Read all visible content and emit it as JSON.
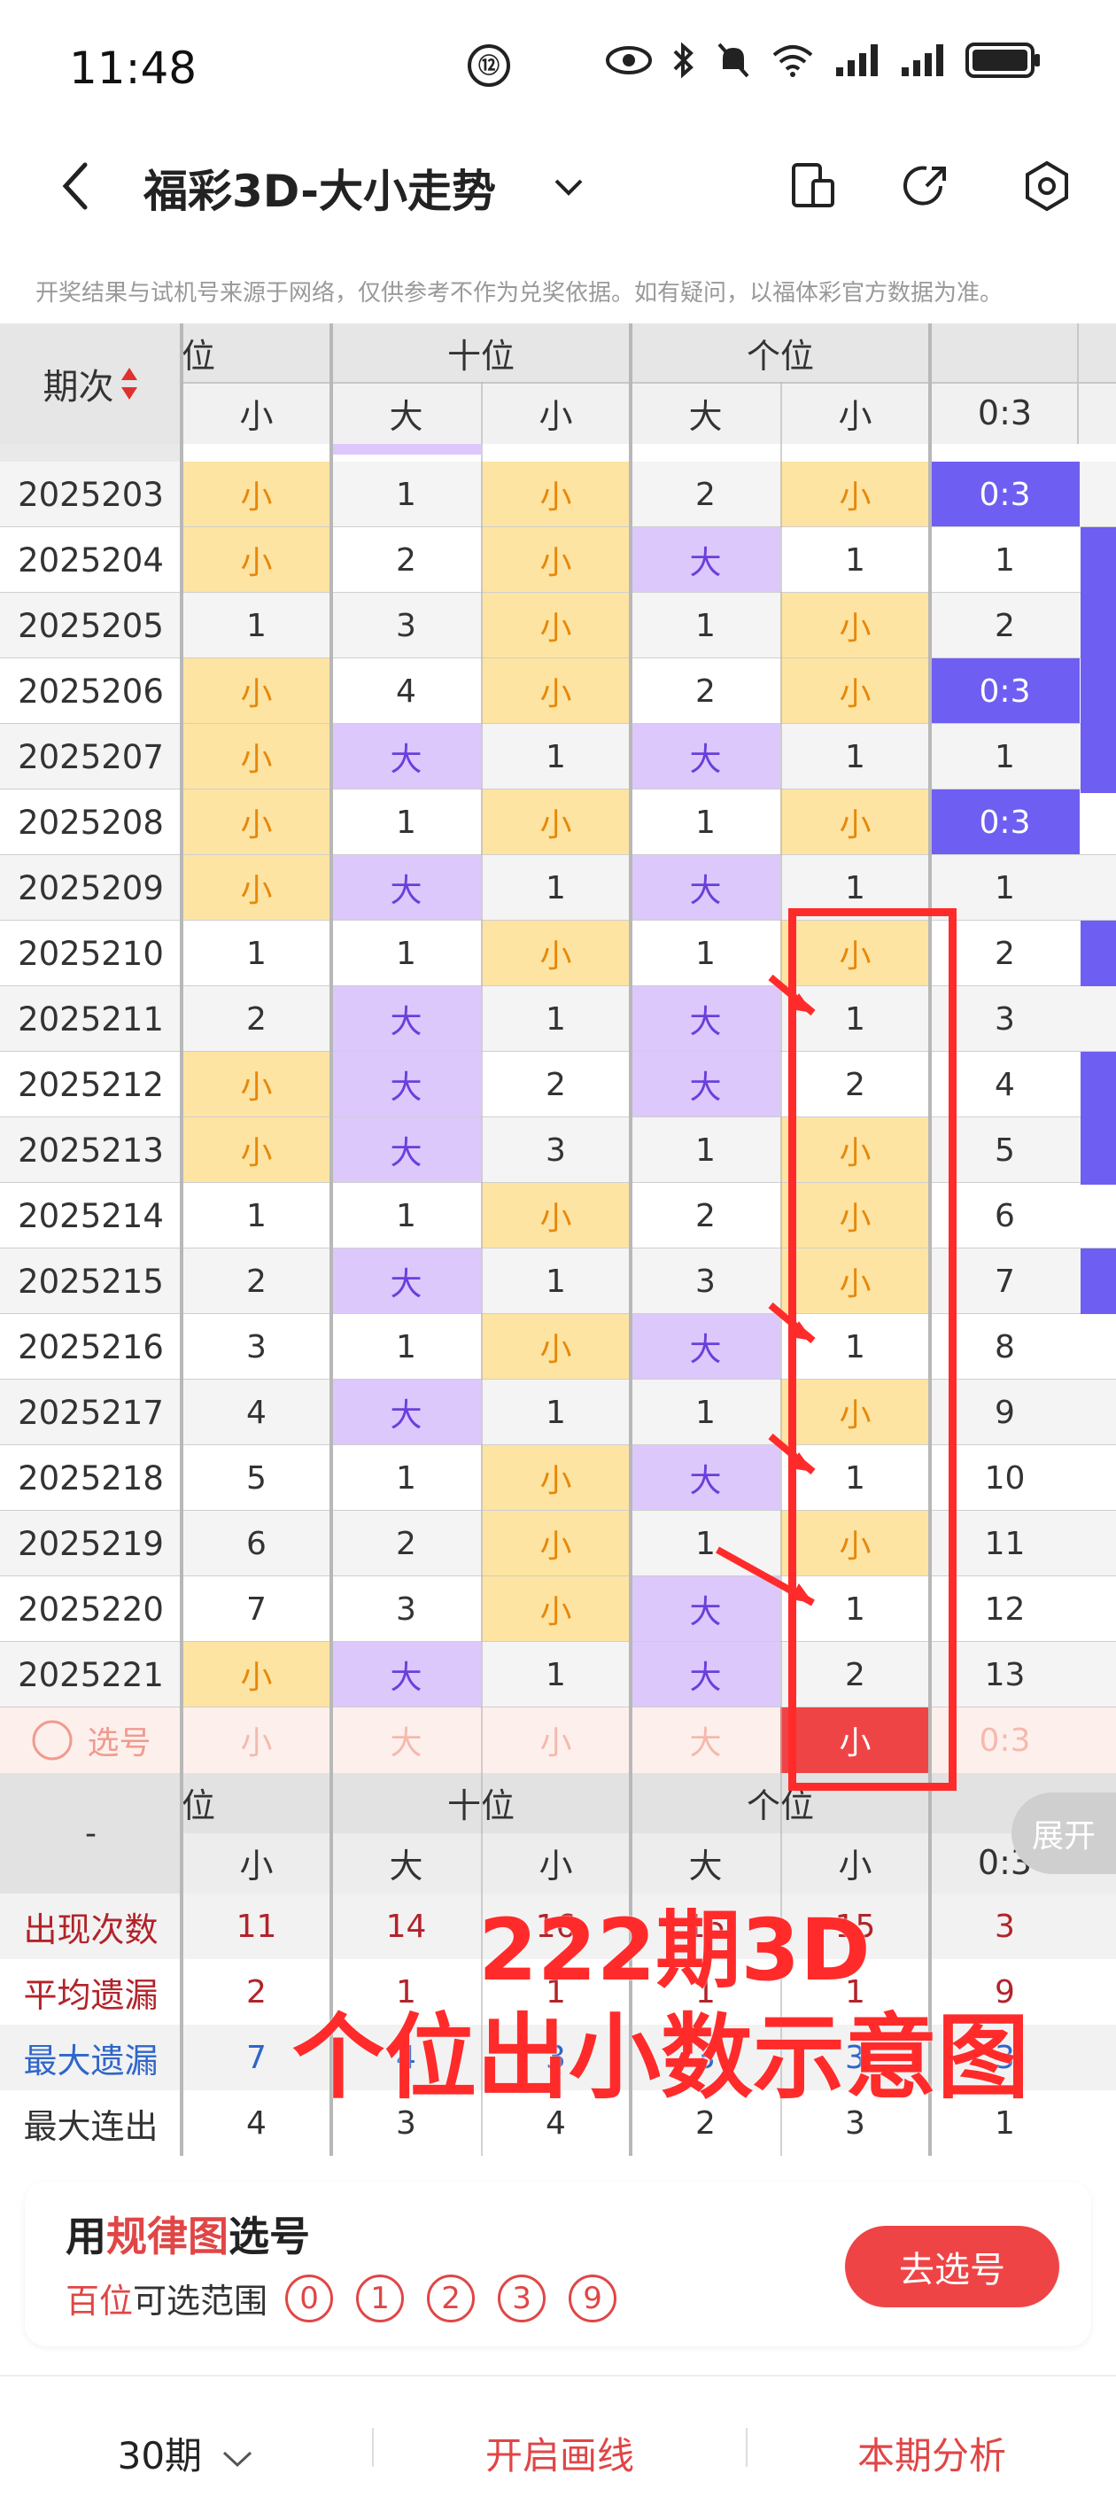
{
  "status": {
    "time": "11:48",
    "badge": "⑫"
  },
  "header": {
    "title": "福彩3D-大小走势"
  },
  "notice": "开奖结果与试机号来源于网络，仅供参考不作为兑奖依据。如有疑问，以福体彩官方数据为准。",
  "table_header": {
    "period_label": "期次",
    "groups": [
      "位",
      "十位",
      "个位"
    ],
    "subheads": [
      "小",
      "大",
      "小",
      "大",
      "小",
      "0:3"
    ]
  },
  "rows": [
    {
      "period": "2025203",
      "cells": [
        "小",
        "1",
        "小",
        "2",
        "小",
        "0:3"
      ]
    },
    {
      "period": "2025204",
      "cells": [
        "小",
        "2",
        "小",
        "大",
        "1",
        "1"
      ]
    },
    {
      "period": "2025205",
      "cells": [
        "1",
        "3",
        "小",
        "1",
        "小",
        "2"
      ]
    },
    {
      "period": "2025206",
      "cells": [
        "小",
        "4",
        "小",
        "2",
        "小",
        "0:3"
      ]
    },
    {
      "period": "2025207",
      "cells": [
        "小",
        "大",
        "1",
        "大",
        "1",
        "1"
      ]
    },
    {
      "period": "2025208",
      "cells": [
        "小",
        "1",
        "小",
        "1",
        "小",
        "0:3"
      ]
    },
    {
      "period": "2025209",
      "cells": [
        "小",
        "大",
        "1",
        "大",
        "1",
        "1"
      ]
    },
    {
      "period": "2025210",
      "cells": [
        "1",
        "1",
        "小",
        "1",
        "小",
        "2"
      ]
    },
    {
      "period": "2025211",
      "cells": [
        "2",
        "大",
        "1",
        "大",
        "1",
        "3"
      ]
    },
    {
      "period": "2025212",
      "cells": [
        "小",
        "大",
        "2",
        "大",
        "2",
        "4"
      ]
    },
    {
      "period": "2025213",
      "cells": [
        "小",
        "大",
        "3",
        "1",
        "小",
        "5"
      ]
    },
    {
      "period": "2025214",
      "cells": [
        "1",
        "1",
        "小",
        "2",
        "小",
        "6"
      ]
    },
    {
      "period": "2025215",
      "cells": [
        "2",
        "大",
        "1",
        "3",
        "小",
        "7"
      ]
    },
    {
      "period": "2025216",
      "cells": [
        "3",
        "1",
        "小",
        "大",
        "1",
        "8"
      ]
    },
    {
      "period": "2025217",
      "cells": [
        "4",
        "大",
        "1",
        "1",
        "小",
        "9"
      ]
    },
    {
      "period": "2025218",
      "cells": [
        "5",
        "1",
        "小",
        "大",
        "1",
        "10"
      ]
    },
    {
      "period": "2025219",
      "cells": [
        "6",
        "2",
        "小",
        "1",
        "小",
        "11"
      ]
    },
    {
      "period": "2025220",
      "cells": [
        "7",
        "3",
        "小",
        "大",
        "1",
        "12"
      ]
    },
    {
      "period": "2025221",
      "cells": [
        "小",
        "大",
        "1",
        "大",
        "2",
        "13"
      ]
    }
  ],
  "select_row": {
    "label": "选号",
    "cells": [
      "小",
      "大",
      "小",
      "大",
      "小",
      "0:3"
    ]
  },
  "stats_header": {
    "dash": "-",
    "groups": [
      "位",
      "十位",
      "个位"
    ],
    "subheads": [
      "小",
      "大",
      "小",
      "大",
      "小",
      "0:3"
    ],
    "expand": "展开"
  },
  "stats": [
    {
      "label": "出现次数",
      "cells": [
        "11",
        "14",
        "16",
        "15",
        "15",
        "3"
      ]
    },
    {
      "label": "平均遗漏",
      "cells": [
        "2",
        "1",
        "1",
        "1",
        "1",
        "9"
      ]
    },
    {
      "label": "最大遗漏",
      "cells": [
        "7",
        "4",
        "3",
        "3",
        "3",
        "3"
      ]
    },
    {
      "label": "最大连出",
      "cells": [
        "4",
        "3",
        "4",
        "2",
        "3",
        "1"
      ]
    }
  ],
  "overlay": {
    "line1": "222期3D",
    "line2": "个位出小数示意图"
  },
  "promo": {
    "pre": "用",
    "highlight": "规律图",
    "post": "选号",
    "range_pos": "百位",
    "range_label": "可选范围",
    "balls": [
      "0",
      "1",
      "2",
      "3",
      "9"
    ],
    "button": "去选号"
  },
  "footer": {
    "periods": "30期",
    "draw": "开启画线",
    "analysis": "本期分析"
  }
}
